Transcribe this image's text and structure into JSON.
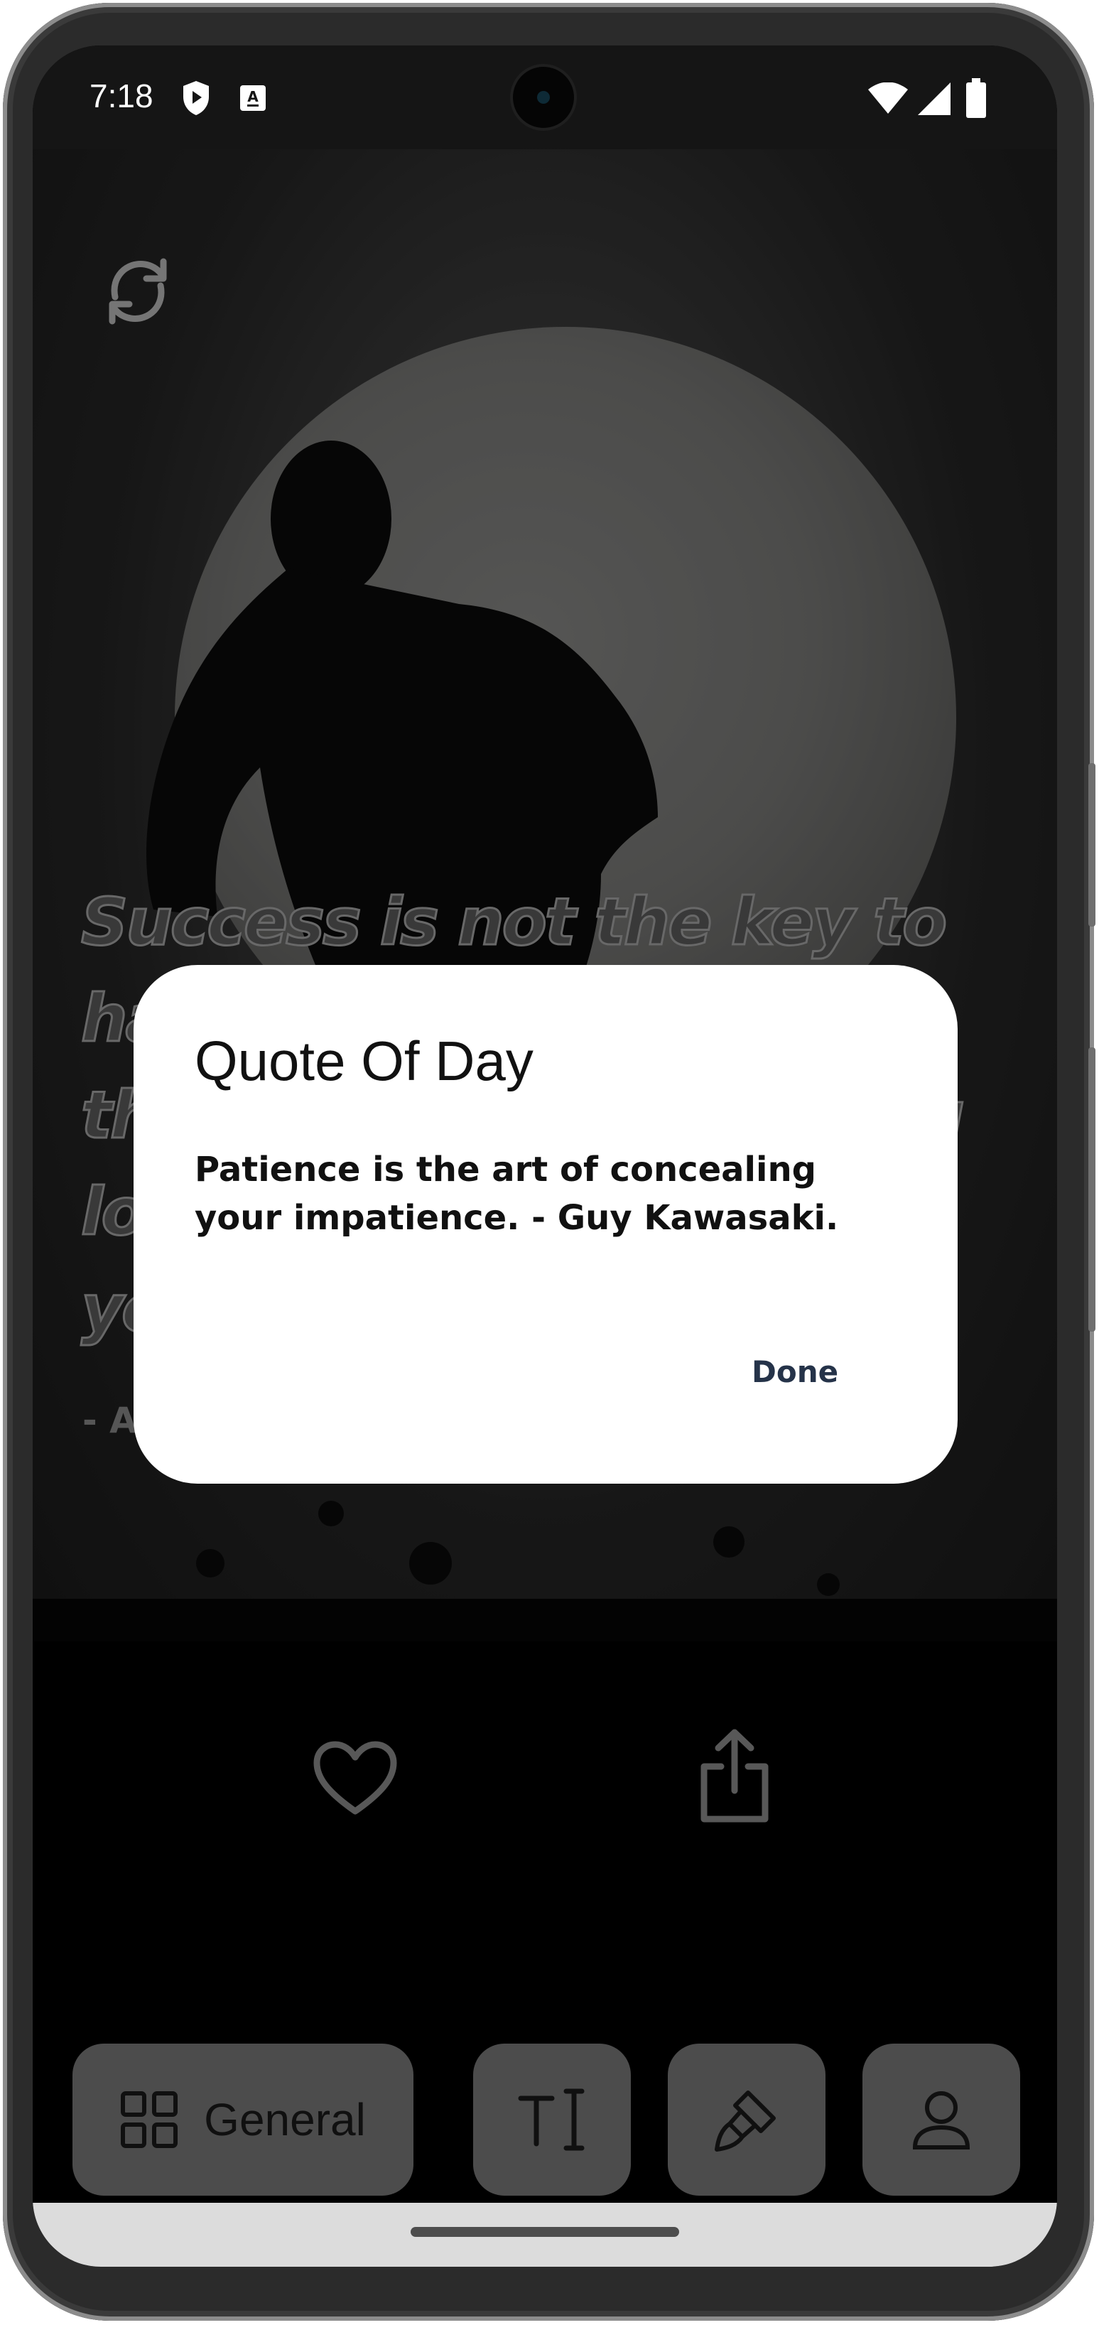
{
  "status_bar": {
    "time": "7:18",
    "icons": [
      "shield-icon",
      "a-keyboard-icon",
      "wifi-icon",
      "signal-icon",
      "battery-icon"
    ]
  },
  "background_quote": {
    "text": "Success is not the key to happiness. Happiness is the key to success. If you love what you are doing, you will be successful.",
    "author": "- A"
  },
  "dialog": {
    "title": "Quote Of Day",
    "body": "Patience is the art of concealing your impatience. - Guy Kawasaki.",
    "done_label": "Done"
  },
  "actions": [
    "heart-icon",
    "share-icon"
  ],
  "tab_bar": {
    "items": [
      {
        "icon": "grid-icon",
        "label": "General"
      },
      {
        "icon": "text-cursor-icon"
      },
      {
        "icon": "paint-brush-icon"
      },
      {
        "icon": "person-icon"
      }
    ]
  },
  "colors": {
    "dialog_bg": "#ffffff",
    "done_text": "#253349",
    "tab_bg": "#7b7b7b",
    "screen_bg": "#000000"
  }
}
